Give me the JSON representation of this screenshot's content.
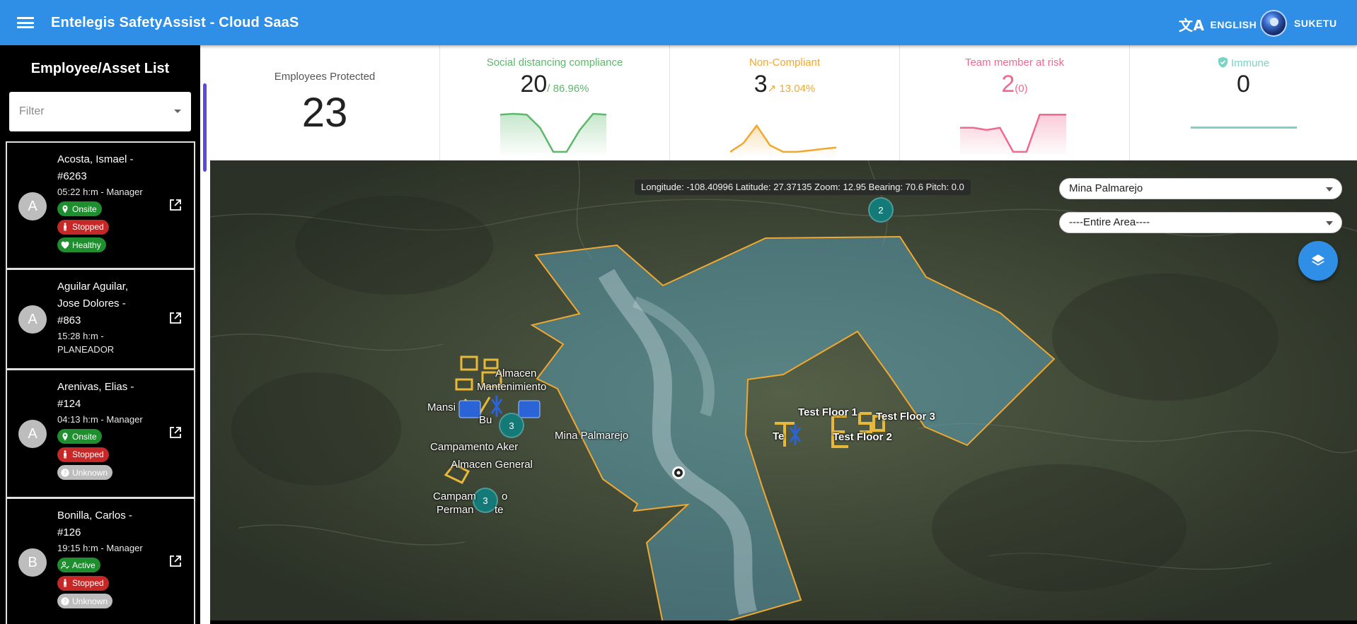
{
  "app": {
    "title": "Entelegis SafetyAssist - Cloud SaaS",
    "language": "ENGLISH",
    "user": "SUKETU"
  },
  "sidebar": {
    "title": "Employee/Asset List",
    "filter_placeholder": "Filter",
    "employees": [
      {
        "initial": "A",
        "name": "Acosta, Ismael - #6263",
        "time_role": "05:22 h:m - Manager",
        "chips": [
          "Onsite",
          "Stopped",
          "Healthy"
        ]
      },
      {
        "initial": "A",
        "name": "Aguilar Aguilar, Jose Dolores - #863",
        "time_role": "15:28 h:m - PLANEADOR",
        "chips": []
      },
      {
        "initial": "A",
        "name": "Arenivas, Elias - #124",
        "time_role": "04:13 h:m - Manager",
        "chips": [
          "Onsite",
          "Stopped",
          "Unknown"
        ]
      },
      {
        "initial": "B",
        "name": "Bonilla, Carlos - #126",
        "time_role": "19:15 h:m - Manager",
        "chips": [
          "Active",
          "Stopped",
          "Unknown"
        ]
      }
    ]
  },
  "stats": {
    "protected": {
      "label": "Employees Protected",
      "value": "23"
    },
    "distancing": {
      "label": "Social distancing compliance",
      "value": "20",
      "sub": "/ 86.96%",
      "color": "#5cb96b",
      "trend": [
        0.9,
        0.92,
        0.9,
        0.6,
        0.05,
        0.05,
        0.55,
        0.92,
        0.9
      ]
    },
    "noncompliant": {
      "label": "Non-Compliant",
      "value": "3",
      "sub": "↗ 13.04%",
      "color": "#f0a830",
      "trend": [
        0.05,
        0.25,
        0.65,
        0.2,
        0.05,
        0.05,
        0.08,
        0.12,
        0.15
      ]
    },
    "atrisk": {
      "label": "Team member at risk",
      "value": "2",
      "sub": "(0)",
      "color": "#ee6b8f",
      "trend": [
        0.6,
        0.6,
        0.55,
        0.6,
        0.05,
        0.05,
        0.9,
        0.9,
        0.9
      ]
    },
    "immune": {
      "label": "Immune",
      "value": "0",
      "color": "#7ad3c4"
    }
  },
  "map": {
    "coords": "Longitude: -108.40996 Latitude: 27.37135 Zoom: 12.95 Bearing: 70.6 Pitch: 0.0",
    "site_select": "Mina Palmarejo",
    "area_select": "----Entire Area----",
    "clusters": [
      "2",
      "3",
      "3"
    ],
    "labels": {
      "almacen": "Almacen",
      "mantenimiento": "Mantenimiento",
      "mansion": "Mansi",
      "bu": "Bu",
      "campamento_aker": "Campamento Aker",
      "almacen_general": "Almacen General",
      "campamento": "Campam",
      "campamento_tail": "o",
      "permanente": "Perman",
      "permanente_tail": "te",
      "mina": "Mina Palmarejo",
      "floor1": "Test Floor 1",
      "floor2": "Test Floor 2",
      "floor3": "Test Floor 3",
      "te": "Te"
    }
  }
}
